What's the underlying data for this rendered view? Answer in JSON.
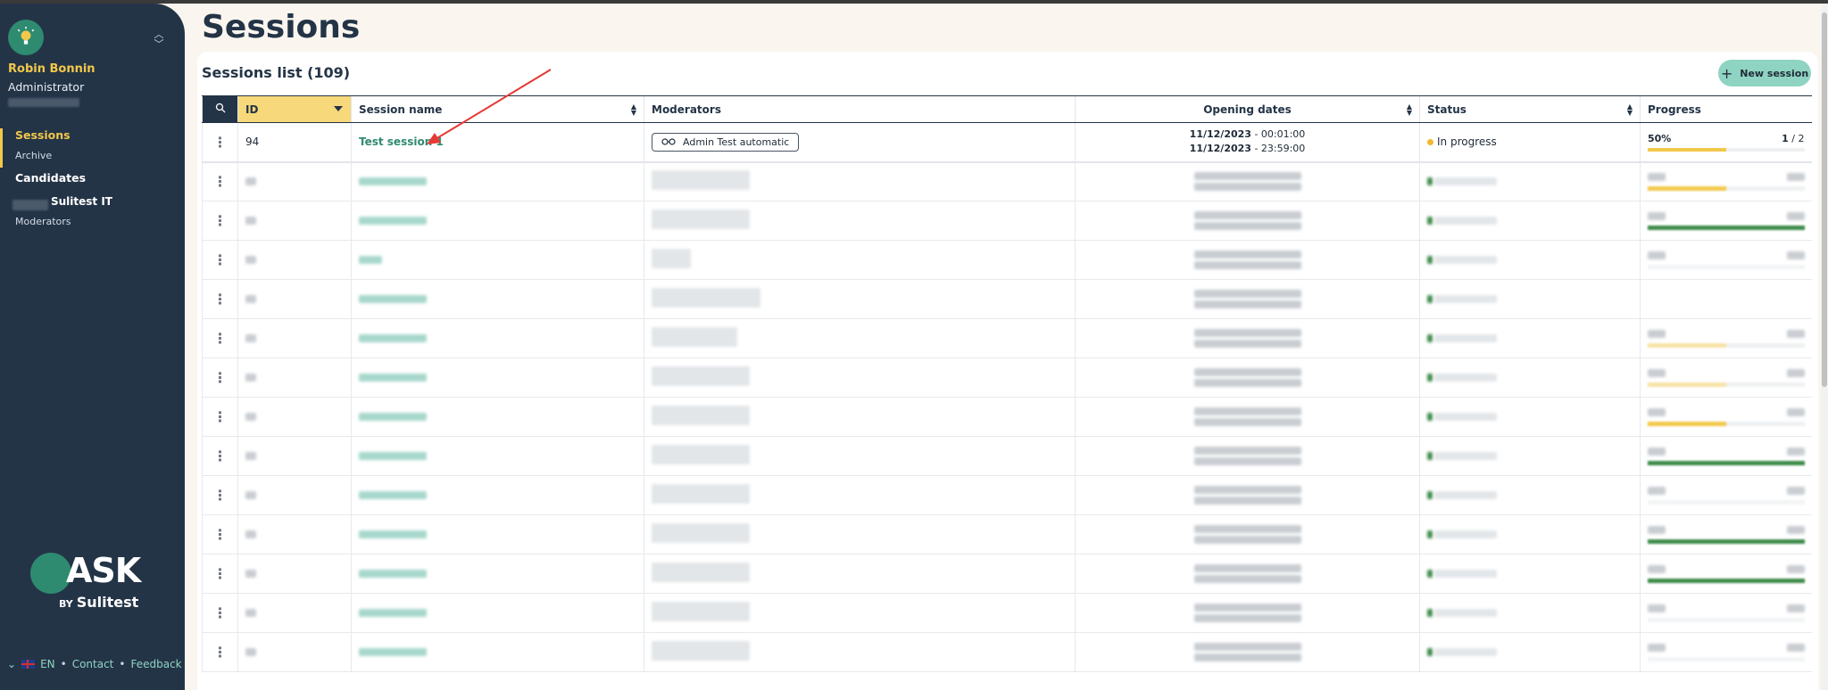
{
  "sidebar": {
    "user_name": "Robin Bonnin",
    "user_role": "Administrator",
    "nav": {
      "sessions": "Sessions",
      "archive": "Archive",
      "candidates": "Candidates",
      "org": "Sulitest IT",
      "moderators": "Moderators"
    },
    "brand": {
      "word": "ASK",
      "by": "BY",
      "company": "Sulitest"
    },
    "footer": {
      "lang": "EN",
      "contact": "Contact",
      "feedback": "Feedback"
    }
  },
  "page": {
    "title": "Sessions",
    "list_title": "Sessions list (109)",
    "new_session": "New session"
  },
  "table": {
    "columns": {
      "id": "ID",
      "session_name": "Session name",
      "moderators": "Moderators",
      "opening_dates": "Opening dates",
      "status": "Status",
      "progress": "Progress"
    },
    "first_row": {
      "id": "94",
      "session_name": "Test session 1",
      "moderator": "Admin Test automatic",
      "date_start": "11/12/2023",
      "time_start": "- 00:01:00",
      "date_end": "11/12/2023",
      "time_end": "- 23:59:00",
      "status": "In progress",
      "progress_percent": "50%",
      "progress_done": "1",
      "progress_total": "/ 2",
      "progress_fraction": 0.5
    }
  },
  "colors": {
    "sidebar_bg": "#243447",
    "accent_yellow": "#f2c84b",
    "accent_teal": "#2e8b70",
    "button_bg": "#8fd4c2",
    "status_in_progress": "#f2b92c",
    "progress_green": "#3e8b4a"
  }
}
